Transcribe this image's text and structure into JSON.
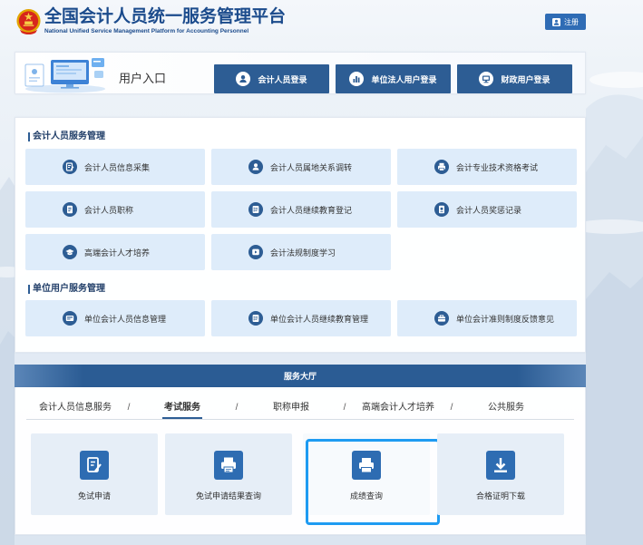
{
  "header": {
    "title": "全国会计人员统一服务管理平台",
    "subtitle": "National Unified Service Management Platform for Accounting Personnel",
    "register": {
      "label": "注册",
      "icon": "user-icon"
    },
    "logo_icon": "national-emblem-icon"
  },
  "entry": {
    "title": "用户入口",
    "buttons": [
      {
        "label": "会计人员登录",
        "icon": "user-icon"
      },
      {
        "label": "单位法人用户登录",
        "icon": "bar-chart-icon"
      },
      {
        "label": "财政用户登录",
        "icon": "monitor-icon"
      }
    ]
  },
  "personal_services": {
    "heading": "会计人员服务管理",
    "items": [
      {
        "label": "会计人员信息采集",
        "icon": "form-edit-icon"
      },
      {
        "label": "会计人员属地关系调转",
        "icon": "person-icon"
      },
      {
        "label": "会计专业技术资格考试",
        "icon": "printer-icon"
      },
      {
        "label": "会计人员职称",
        "icon": "document-icon"
      },
      {
        "label": "会计人员继续教育登记",
        "icon": "list-icon"
      },
      {
        "label": "会计人员奖惩记录",
        "icon": "record-icon"
      },
      {
        "label": "高端会计人才培养",
        "icon": "graduation-cap-icon"
      },
      {
        "label": "会计法规制度学习",
        "icon": "play-icon"
      }
    ]
  },
  "unit_services": {
    "heading": "单位用户服务管理",
    "items": [
      {
        "label": "单位会计人员信息管理",
        "icon": "id-card-icon"
      },
      {
        "label": "单位会计人员继续教育管理",
        "icon": "list-icon"
      },
      {
        "label": "单位会计准则制度反馈意见",
        "icon": "briefcase-icon"
      }
    ]
  },
  "service_hall": {
    "title": "服务大厅",
    "separator": "/",
    "tabs": [
      "会计人员信息服务",
      "考试服务",
      "职称申报",
      "高端会计人才培养",
      "公共服务"
    ],
    "active_tab_index": 1,
    "cards": [
      {
        "label": "免试申请",
        "icon": "edit-document-icon"
      },
      {
        "label": "免试申请结果查询",
        "icon": "stamp-icon"
      },
      {
        "label": "成绩查询",
        "icon": "printer-icon"
      },
      {
        "label": "合格证明下载",
        "icon": "download-icon"
      }
    ],
    "highlighted_card_index": 2
  },
  "colors": {
    "primary": "#2d5d94",
    "title": "#1b4b8c",
    "card_bg": "#deecfa",
    "hall_card_bg": "#e6eef7",
    "hall_icon": "#2e6cb2",
    "highlight": "#1e9bf2",
    "register": "#2f6cb5"
  }
}
